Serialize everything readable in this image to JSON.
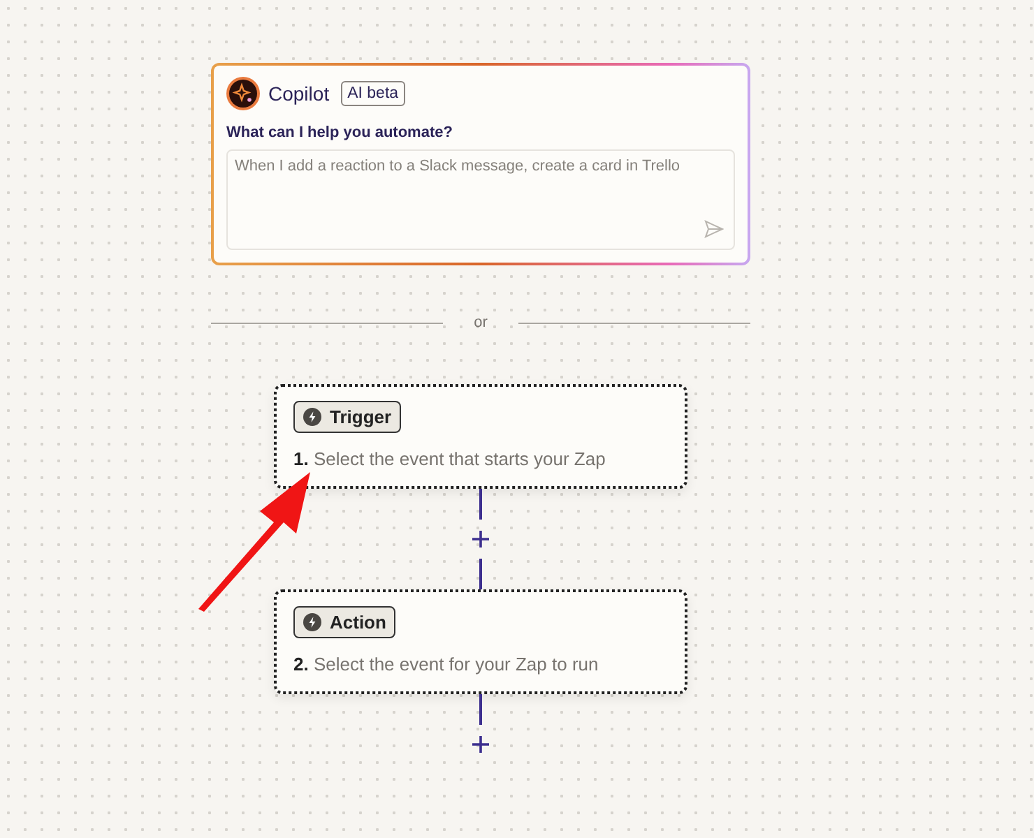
{
  "copilot": {
    "title": "Copilot",
    "badge": "AI beta",
    "prompt_label": "What can I help you automate?",
    "input": {
      "placeholder": "When I add a reaction to a Slack message, create a card in Trello"
    }
  },
  "divider": {
    "label": "or"
  },
  "steps": [
    {
      "tag": "Trigger",
      "number": "1.",
      "text": "Select the event that starts your Zap"
    },
    {
      "tag": "Action",
      "number": "2.",
      "text": "Select the event for your Zap to run"
    }
  ],
  "annotation": {
    "kind": "arrow"
  }
}
